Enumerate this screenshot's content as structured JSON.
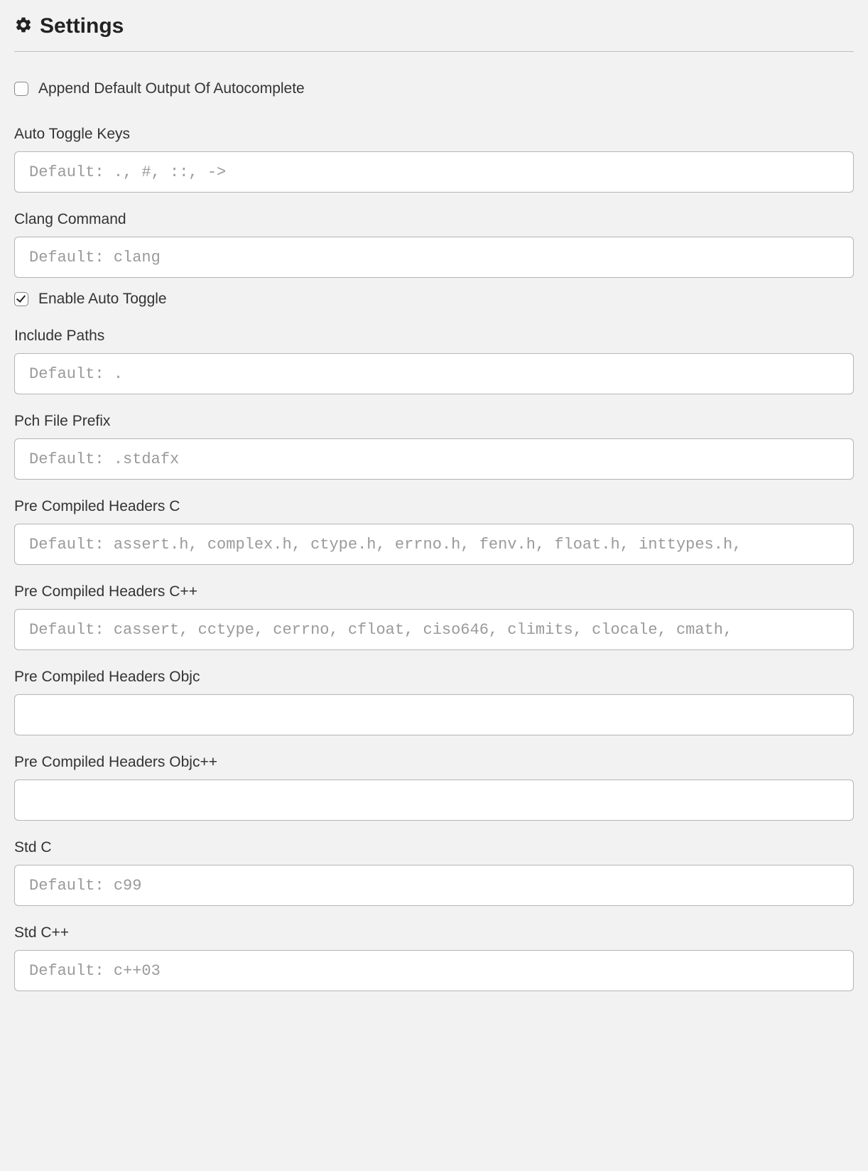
{
  "header": {
    "title": "Settings"
  },
  "settings": {
    "append_default_output": {
      "label": "Append Default Output Of Autocomplete",
      "checked": false
    },
    "auto_toggle_keys": {
      "label": "Auto Toggle Keys",
      "value": "",
      "placeholder": "Default: ., #, ::, ->"
    },
    "clang_command": {
      "label": "Clang Command",
      "value": "",
      "placeholder": "Default: clang"
    },
    "enable_auto_toggle": {
      "label": "Enable Auto Toggle",
      "checked": true
    },
    "include_paths": {
      "label": "Include Paths",
      "value": "",
      "placeholder": "Default: ."
    },
    "pch_file_prefix": {
      "label": "Pch File Prefix",
      "value": "",
      "placeholder": "Default: .stdafx"
    },
    "pre_compiled_headers_c": {
      "label": "Pre Compiled Headers C",
      "value": "",
      "placeholder": "Default: assert.h, complex.h, ctype.h, errno.h, fenv.h, float.h, inttypes.h,"
    },
    "pre_compiled_headers_cpp": {
      "label": "Pre Compiled Headers C++",
      "value": "",
      "placeholder": "Default: cassert, cctype, cerrno, cfloat, ciso646, climits, clocale, cmath,"
    },
    "pre_compiled_headers_objc": {
      "label": "Pre Compiled Headers Objc",
      "value": "",
      "placeholder": ""
    },
    "pre_compiled_headers_objcpp": {
      "label": "Pre Compiled Headers Objc++",
      "value": "",
      "placeholder": ""
    },
    "std_c": {
      "label": "Std C",
      "value": "",
      "placeholder": "Default: c99"
    },
    "std_cpp": {
      "label": "Std C++",
      "value": "",
      "placeholder": "Default: c++03"
    }
  }
}
